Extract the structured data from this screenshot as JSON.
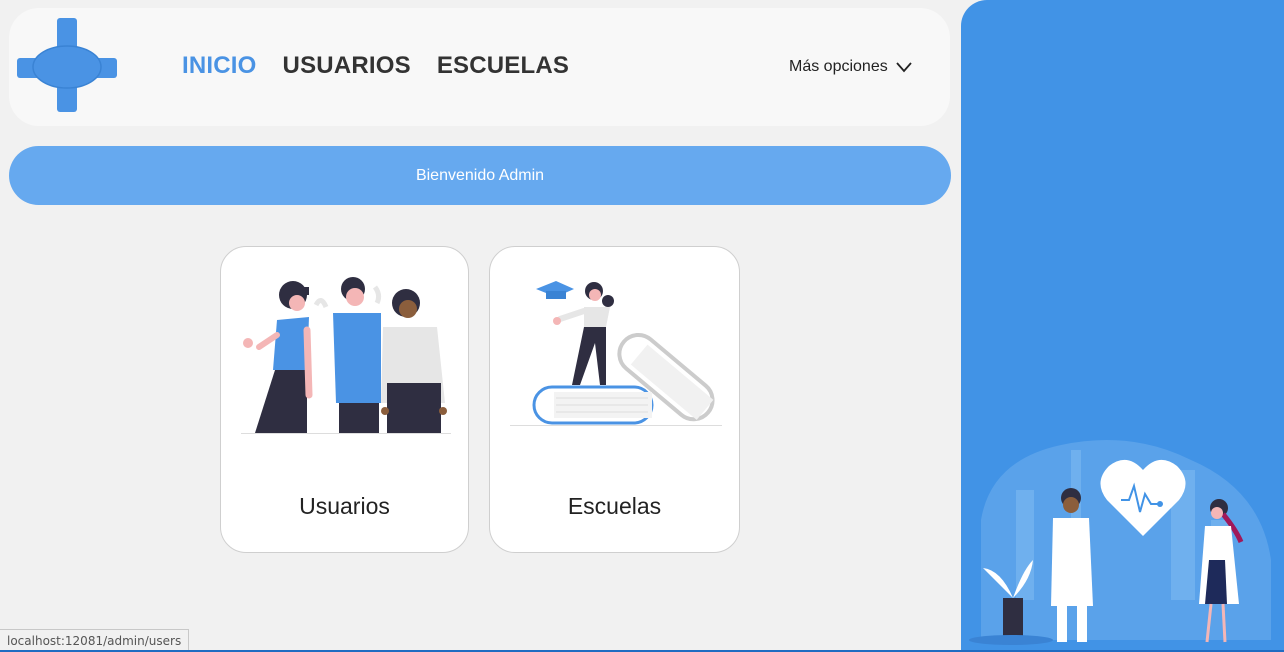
{
  "header": {
    "nav": [
      {
        "label": "INICIO",
        "active": true
      },
      {
        "label": "USUARIOS",
        "active": false
      },
      {
        "label": "ESCUELAS",
        "active": false
      }
    ],
    "more_label": "Más opciones",
    "logo_icon": "medical-cross-icon"
  },
  "welcome": {
    "text": "Bienvenido Admin"
  },
  "cards": [
    {
      "label": "Usuarios",
      "icon": "people-illustration"
    },
    {
      "label": "Escuelas",
      "icon": "graduate-book-illustration"
    }
  ],
  "side_panel": {
    "illustration": "doctors-heart-illustration"
  },
  "status": {
    "url": "localhost:12081/admin/users"
  },
  "colors": {
    "accent": "#4a93e4",
    "panel": "#4193e6",
    "welcome": "#66a9ef",
    "text": "#333333"
  }
}
